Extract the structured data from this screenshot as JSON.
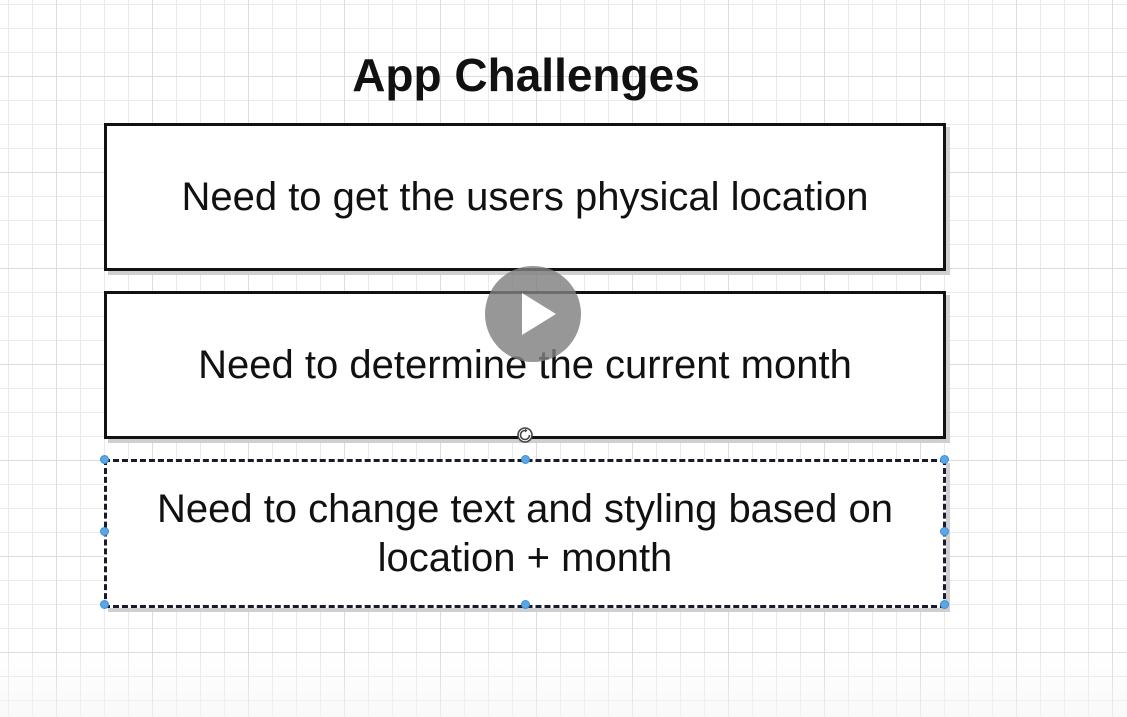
{
  "diagram": {
    "title": "App Challenges",
    "boxes": [
      {
        "text": "Need to get the users physical location"
      },
      {
        "text": "Need to determine the current month"
      },
      {
        "text": "Need to change text and styling based on location + month"
      }
    ]
  },
  "overlay": {
    "play_icon": "play-icon",
    "rotate_icon": "rotate-icon"
  },
  "colors": {
    "selection": "#5aa7e8",
    "play_button": "#808080",
    "border": "#111111"
  }
}
